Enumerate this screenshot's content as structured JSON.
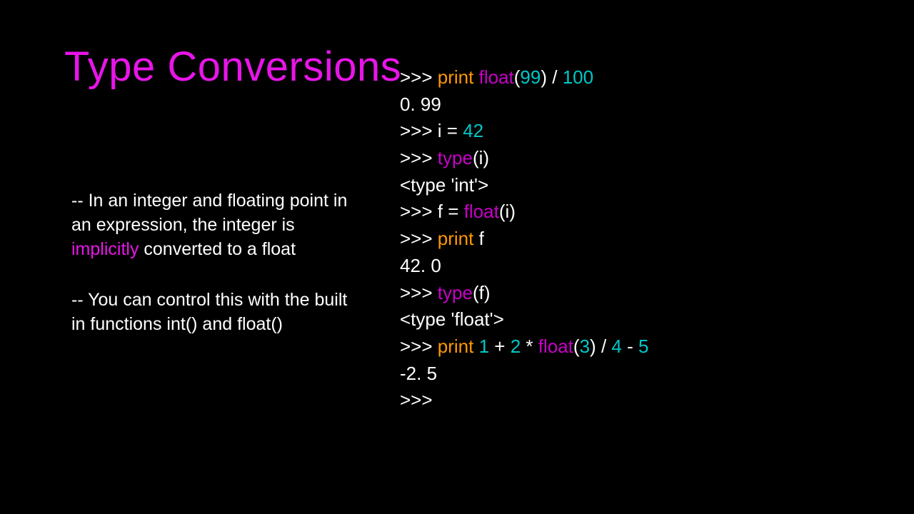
{
  "title": "Type Conversions",
  "bullets": {
    "b1_pre": "-- In an integer and floating point in an expression, the integer is ",
    "b1_emph": "implicitly",
    "b1_post": " converted to a float",
    "b2": "-- You can control this with the built in functions int() and float()"
  },
  "code": {
    "prompt": ">>> ",
    "prompt_bare": ">>>",
    "print": "print",
    "float": "float",
    "type": "type",
    "lparen": "(",
    "rparen": ")",
    "n99": "99",
    "n100": "100",
    "n42": "42",
    "n1": "1",
    "n2": "2",
    "n3": "3",
    "n4": "4",
    "n5": "5",
    "slash": " / ",
    "plus": " + ",
    "star": " * ",
    "minus": " - ",
    "eq": " = ",
    "i": "i",
    "f": "f",
    "sp": " ",
    "out099": "0. 99",
    "outTypeInt": "<type 'int'>",
    "out42": "42. 0",
    "outTypeFloat": "<type 'float'>",
    "outNeg25": "-2. 5",
    "iExpr": "i = 42"
  }
}
